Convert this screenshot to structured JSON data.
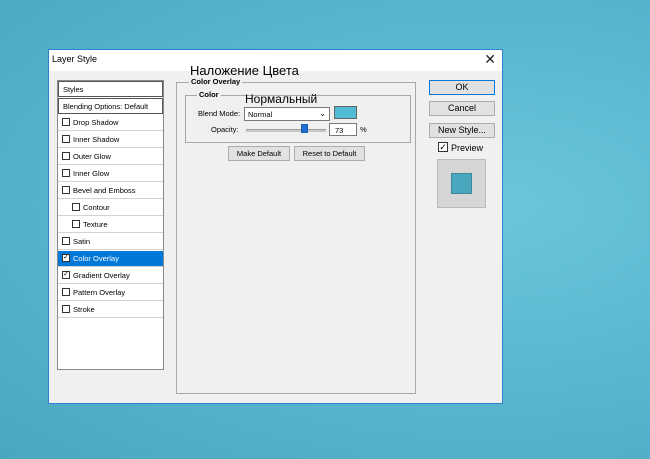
{
  "dialog": {
    "title": "Layer Style",
    "close_glyph": "✕"
  },
  "overlay_caption": "Наложение Цвета",
  "styles_panel": {
    "header": "Styles",
    "blending": "Blending Options: Default",
    "items": [
      {
        "label": "Drop Shadow",
        "checked": false,
        "indent": false,
        "selected": false
      },
      {
        "label": "Inner Shadow",
        "checked": false,
        "indent": false,
        "selected": false
      },
      {
        "label": "Outer Glow",
        "checked": false,
        "indent": false,
        "selected": false
      },
      {
        "label": "Inner Glow",
        "checked": false,
        "indent": false,
        "selected": false
      },
      {
        "label": "Bevel and Emboss",
        "checked": false,
        "indent": false,
        "selected": false
      },
      {
        "label": "Contour",
        "checked": false,
        "indent": true,
        "selected": false
      },
      {
        "label": "Texture",
        "checked": false,
        "indent": true,
        "selected": false
      },
      {
        "label": "Satin",
        "checked": false,
        "indent": false,
        "selected": false
      },
      {
        "label": "Color Overlay",
        "checked": true,
        "indent": false,
        "selected": true
      },
      {
        "label": "Gradient Overlay",
        "checked": true,
        "indent": false,
        "selected": false
      },
      {
        "label": "Pattern Overlay",
        "checked": false,
        "indent": false,
        "selected": false
      },
      {
        "label": "Stroke",
        "checked": false,
        "indent": false,
        "selected": false
      }
    ]
  },
  "color_overlay": {
    "legend": "Color Overlay",
    "color_legend": "Color",
    "blend_mode_label": "Blend Mode:",
    "blend_mode_value": "Normal",
    "blend_mode_caption": "Нормальный",
    "swatch_color": "#50bcd4",
    "opacity_label": "Opacity:",
    "opacity_value": "73",
    "opacity_unit": "%",
    "opacity_fraction": 0.73,
    "make_default": "Make Default",
    "reset_default": "Reset to Default"
  },
  "right_buttons": {
    "ok": "OK",
    "cancel": "Cancel",
    "new_style": "New Style...",
    "preview_label": "Preview",
    "preview_checked": true
  },
  "colors": {
    "selected_row": "#0078d7",
    "preview_swatch": "#4aa7bd"
  }
}
